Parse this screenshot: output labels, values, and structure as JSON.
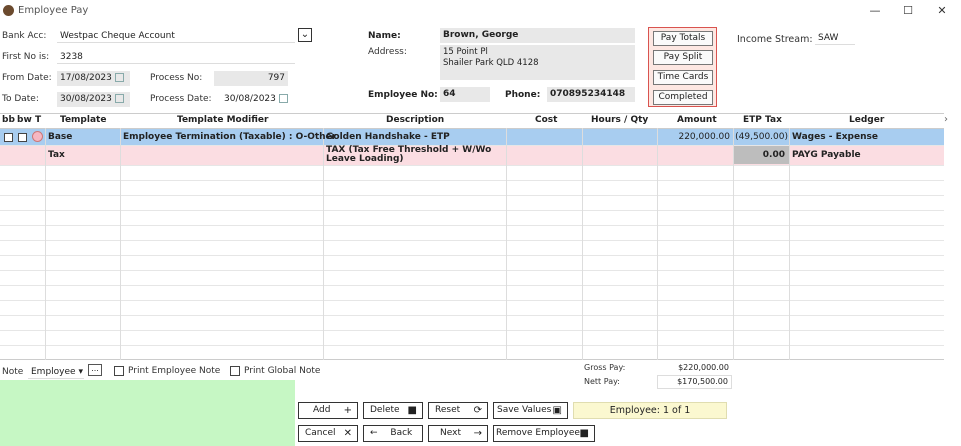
{
  "window": {
    "title": "Employee Pay",
    "minimize": "—",
    "maximize": "☐",
    "close": "✕"
  },
  "header": {
    "bank_acc_label": "Bank Acc:",
    "bank_acc_value": "Westpac Cheque Account",
    "first_no_label": "First No is:",
    "first_no_value": "3238",
    "from_date_label": "From Date:",
    "from_date_value": "17/08/2023",
    "to_date_label": "To Date:",
    "to_date_value": "30/08/2023",
    "process_no_label": "Process No:",
    "process_no_value": "797",
    "process_date_label": "Process Date:",
    "process_date_value": "30/08/2023",
    "name_label": "Name:",
    "name_value": "Brown, George",
    "address_label": "Address:",
    "address_line1": "15 Point Pl",
    "address_line2": "Shailer Park QLD 4128",
    "employee_no_label": "Employee No:",
    "employee_no_value": "64",
    "phone_label": "Phone:",
    "phone_value": "070895234148",
    "income_stream_label": "Income Stream:",
    "income_stream_value": "SAW"
  },
  "side_buttons": {
    "pay_totals": "Pay Totals",
    "pay_split": "Pay Split",
    "time_cards": "Time Cards",
    "completed": "Completed"
  },
  "grid": {
    "columns": {
      "bb": "bb",
      "bw": "bw",
      "t": "T",
      "template": "Template",
      "modifier": "Template Modifier",
      "description": "Description",
      "cost": "Cost",
      "hours": "Hours / Qty",
      "amount": "Amount",
      "etp_tax": "ETP Tax",
      "ledger": "Ledger"
    },
    "rows": [
      {
        "template": "Base",
        "modifier": "Employee Termination (Taxable) : O-Other",
        "description": "Golden Handshake - ETP",
        "amount": "220,000.00",
        "etp_tax": "(49,500.00)",
        "ledger": "Wages - Expense"
      },
      {
        "template": "Tax",
        "description_line1": "TAX (Tax Free Threshold  + W/Wo",
        "description_line2": "Leave Loading)",
        "etp_tax": "0.00",
        "ledger": "PAYG Payable"
      }
    ]
  },
  "footer": {
    "note_label": "Note",
    "note_select": "Employee",
    "note_more": "...",
    "print_employee_note": "Print Employee Note",
    "print_global_note": "Print Global Note",
    "gross_pay_label": "Gross Pay:",
    "gross_pay_value": "$220,000.00",
    "nett_pay_label": "Nett Pay:",
    "nett_pay_value": "$170,500.00",
    "employee_counter": "Employee: 1 of 1"
  },
  "buttons": {
    "add": "Add",
    "delete": "Delete",
    "reset": "Reset",
    "save_values": "Save Values",
    "cancel": "Cancel",
    "back": "Back",
    "next": "Next",
    "remove_employee": "Remove Employee"
  },
  "colors": {
    "selected_row": "#a8cdf0",
    "tax_row": "#fbdde2",
    "note_area": "#c6f7c4",
    "counter_bg": "#fbf8d0",
    "side_panel_border": "#d9534f",
    "side_panel_bg": "#fde7e2"
  }
}
